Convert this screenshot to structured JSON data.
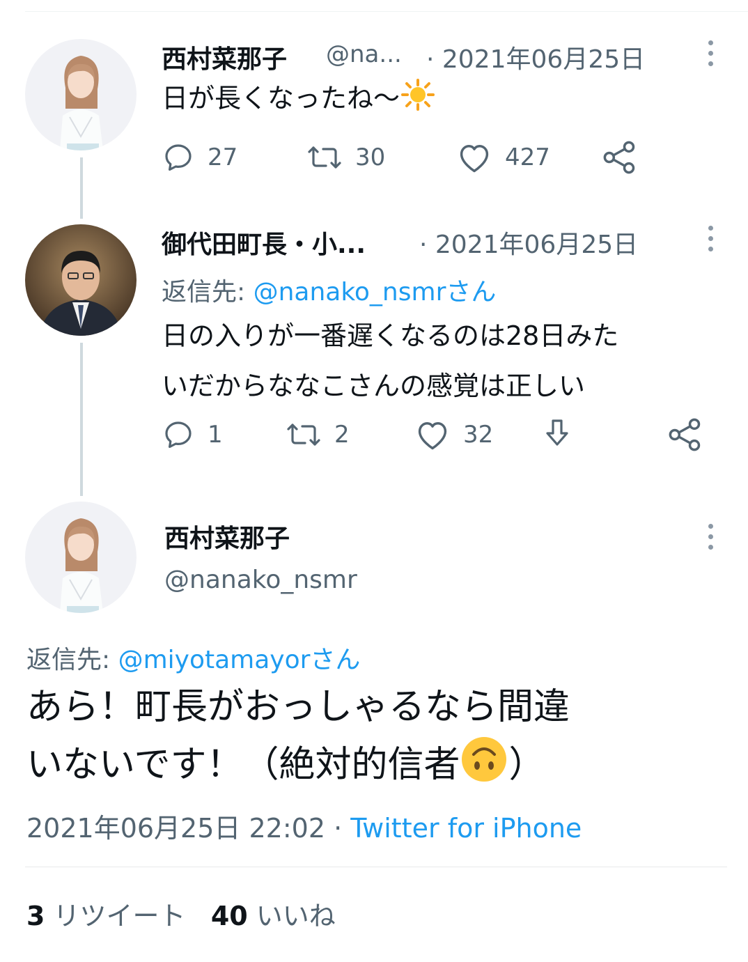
{
  "tweet1": {
    "name": "西村菜那子",
    "handle": "@na...",
    "date": "· 2021年06月25日",
    "text": "日が長くなったね〜",
    "emoji": "sun-emoji",
    "reply_count": "27",
    "retweet_count": "30",
    "like_count": "427"
  },
  "tweet2": {
    "name": "御代田町長・小...",
    "date": "· 2021年06月25日",
    "reply_to_label": "返信先: ",
    "reply_to_handle": "@nanako_nsmrさん",
    "text_line1": "日の入りが一番遅くなるのは28日みた",
    "text_line2": "いだからななこさんの感覚は正しい",
    "reply_count": "1",
    "retweet_count": "2",
    "like_count": "32"
  },
  "main_tweet": {
    "name": "西村菜那子",
    "handle": "@nanako_nsmr",
    "reply_to_label": "返信先: ",
    "reply_to_handle": "@miyotamayorさん",
    "text_line1": "あら！町長がおっしゃるなら間違",
    "text_line2": "いないです！（絶対的信者",
    "text_line2_end": "）",
    "emoji": "upside-down-face-emoji",
    "timestamp": "2021年06月25日 22:02 · ",
    "source": "Twitter for iPhone",
    "retweets_count": "3",
    "retweets_label": "リツイート",
    "likes_count": "40",
    "likes_label": "いいね"
  },
  "colors": {
    "accent": "#1d9bf0",
    "muted": "#536471",
    "text": "#0f1419",
    "thread_line": "#cfd9de"
  }
}
